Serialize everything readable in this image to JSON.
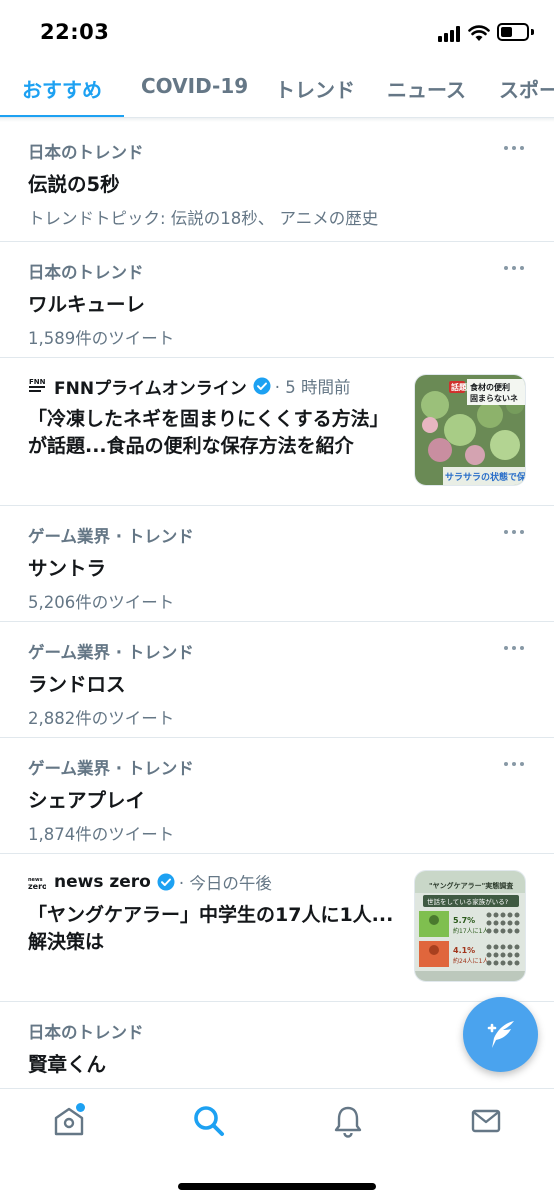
{
  "status_bar": {
    "time": "22:03"
  },
  "tabs": [
    {
      "label": "おすすめ",
      "active": true
    },
    {
      "label": "COVID-19",
      "active": false
    },
    {
      "label": "トレンド",
      "active": false
    },
    {
      "label": "ニュース",
      "active": false
    },
    {
      "label": "スポー",
      "active": false
    }
  ],
  "feed": {
    "trend1": {
      "context": "日本のトレンド",
      "title": "伝説の5秒",
      "meta": "トレンドトピック: 伝説の18秒、 アニメの歴史"
    },
    "trend2": {
      "context": "日本のトレンド",
      "title": "ワルキューレ",
      "meta": "1,589件のツイート"
    },
    "news1": {
      "source": "FNNプライムオンライン",
      "time": "· 5 時間前",
      "headline": "「冷凍したネギを固まりにくくする方法」が話題...食品の便利な保存方法を紹介",
      "thumb_text_top": "話題",
      "thumb_text_top2": "食材の便利",
      "thumb_text_top3": "固まらないネ",
      "thumb_caption": "サラサラの状態で保"
    },
    "trend3": {
      "context": "ゲーム業界 · トレンド",
      "title": "サントラ",
      "meta": "5,206件のツイート"
    },
    "trend4": {
      "context": "ゲーム業界 · トレンド",
      "title": "ランドロス",
      "meta": "2,882件のツイート"
    },
    "trend5": {
      "context": "ゲーム業界 · トレンド",
      "title": "シェアプレイ",
      "meta": "1,874件のツイート"
    },
    "news2": {
      "source": "news zero",
      "time": "· 今日の午後",
      "headline": "「ヤングケアラー」中学生の17人に1人...解決策は",
      "thumb_title": "\"ヤングケアラー\"実態調査",
      "thumb_question": "世話をしている家族がいる?",
      "thumb_stat1": "5.7%",
      "thumb_stat1_sub": "約17人に1人",
      "thumb_stat2": "4.1%",
      "thumb_stat2_sub": "約24人に1人"
    },
    "trend6": {
      "context": "日本のトレンド",
      "title": "賢章くん"
    }
  },
  "colors": {
    "accent": "#1da1f2",
    "secondary_text": "#657786",
    "fab": "#4aa3ee"
  },
  "icons": [
    "home-icon",
    "search-icon",
    "bell-icon",
    "mail-icon",
    "compose-tweet-icon",
    "verified-badge-icon",
    "more-options-icon"
  ]
}
